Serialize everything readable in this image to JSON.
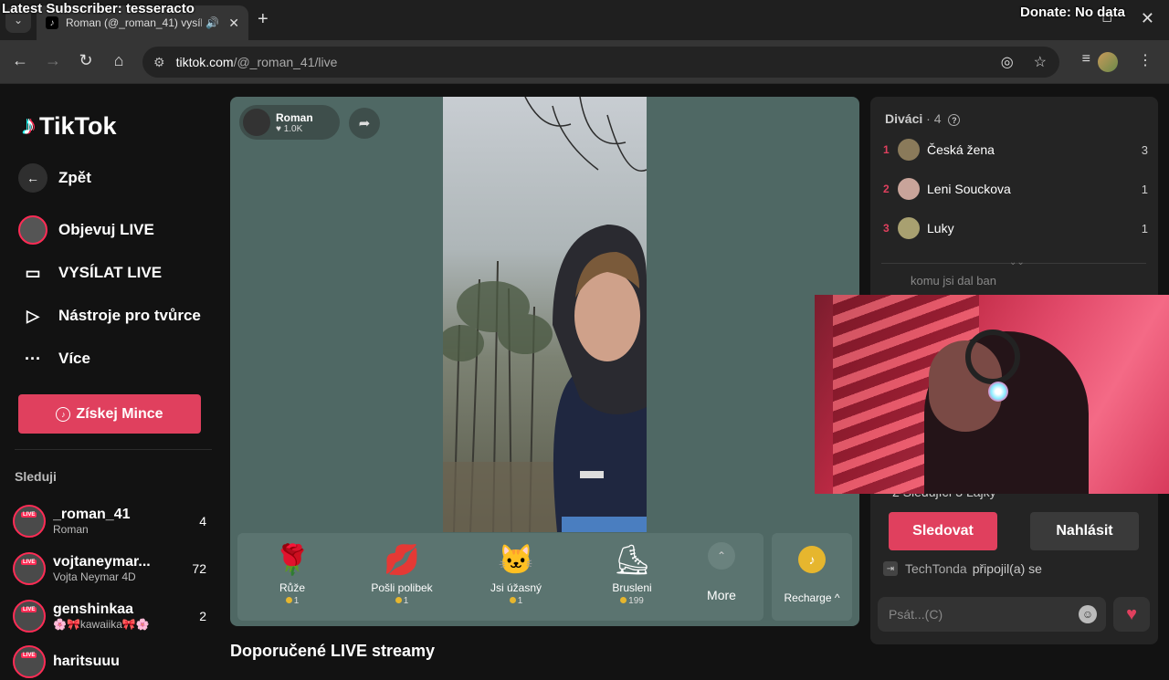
{
  "overlay": {
    "latest_subscriber": "Latest Subscriber: tesseracto",
    "donate": "Donate: No data"
  },
  "browser": {
    "tab_title": "Roman (@_roman_41) vysíl...",
    "url_host": "tiktok.com",
    "url_path": "/@_roman_41/live"
  },
  "sidebar": {
    "logo": "TikTok",
    "back": "Zpět",
    "nav": [
      {
        "label": "Objevuj LIVE"
      },
      {
        "label": "VYSÍLAT LIVE"
      },
      {
        "label": "Nástroje pro tvůrce"
      },
      {
        "label": "Více"
      }
    ],
    "coins_button": "Získej Mince",
    "following_title": "Sleduji",
    "following": [
      {
        "name": "_roman_41",
        "sub": "Roman",
        "count": "4"
      },
      {
        "name": "vojtaneymar...",
        "sub": "Vojta Neymar 4D",
        "count": "72"
      },
      {
        "name": "genshinkaa",
        "sub": "🌸🎀kawaiika🎀🌸",
        "count": "2"
      },
      {
        "name": "haritsuuu",
        "sub": "",
        "count": ""
      }
    ],
    "live_badge": "LIVE"
  },
  "stream": {
    "host_name": "Roman",
    "host_likes": "♥ 1.0K",
    "gifts": [
      {
        "icon": "🌹",
        "name": "Růže",
        "price": "1"
      },
      {
        "icon": "💋",
        "name": "Pošli polibek",
        "price": "1"
      },
      {
        "icon": "🐱",
        "name": "Jsi úžasný",
        "price": "1"
      },
      {
        "icon": "⛸",
        "name": "Brusleni",
        "price": "199"
      }
    ],
    "more_label": "More",
    "recharge_label": "Recharge ^"
  },
  "recommended_title": "Doporučené LIVE streamy",
  "chat": {
    "viewers_title": "Diváci",
    "viewers_count": "· 4",
    "viewers": [
      {
        "rank": "1",
        "name": "Česká žena",
        "score": "3"
      },
      {
        "rank": "2",
        "name": "Leni Souckova",
        "score": "1"
      },
      {
        "rank": "3",
        "name": "Luky",
        "score": "1"
      }
    ],
    "ban_text": "komu jsi dal ban",
    "stats": "2  Sledující    3  Lajky",
    "follow_button": "Sledovat",
    "report_button": "Nahlásit",
    "join_user": "TechTonda",
    "join_text": "připojil(a) se",
    "input_placeholder": "Psát...(C)"
  }
}
